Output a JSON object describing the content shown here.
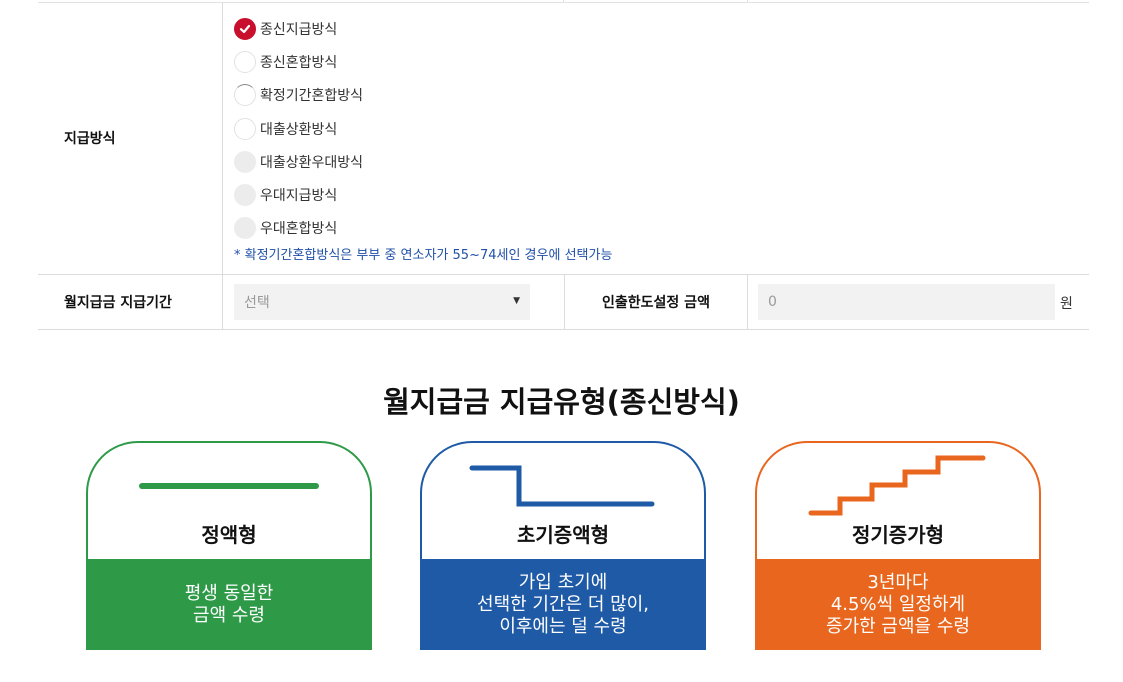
{
  "payment_method": {
    "label": "지급방식",
    "options": [
      {
        "label": "종신지급방식",
        "state": "checked"
      },
      {
        "label": "종신혼합방식",
        "state": "enabled"
      },
      {
        "label": "확정기간혼합방식",
        "state": "enabled"
      },
      {
        "label": "대출상환방식",
        "state": "enabled"
      },
      {
        "label": "대출상환우대방식",
        "state": "disabled"
      },
      {
        "label": "우대지급방식",
        "state": "disabled"
      },
      {
        "label": "우대혼합방식",
        "state": "disabled"
      }
    ],
    "note": "* 확정기간혼합방식은 부부 중 연소자가 55~74세인 경우에 선택가능"
  },
  "period": {
    "label": "월지급금 지급기간",
    "select_value": "선택"
  },
  "limit": {
    "label": "인출한도설정 금액",
    "placeholder": "0",
    "unit": "원"
  },
  "section": {
    "title": "월지급금 지급유형(종신방식)"
  },
  "cards": [
    {
      "title": "정액형",
      "desc": [
        "평생 동일한",
        "금액 수령"
      ],
      "color": "#2e9a48"
    },
    {
      "title": "초기증액형",
      "desc": [
        "가입 초기에",
        "선택한 기간은 더 많이,",
        "이후에는 덜 수령"
      ],
      "color": "#1e5aa6"
    },
    {
      "title": "정기증가형",
      "desc": [
        "3년마다",
        "4.5%씩 일정하게",
        "증가한 금액을 수령"
      ],
      "color": "#e8661d"
    }
  ]
}
